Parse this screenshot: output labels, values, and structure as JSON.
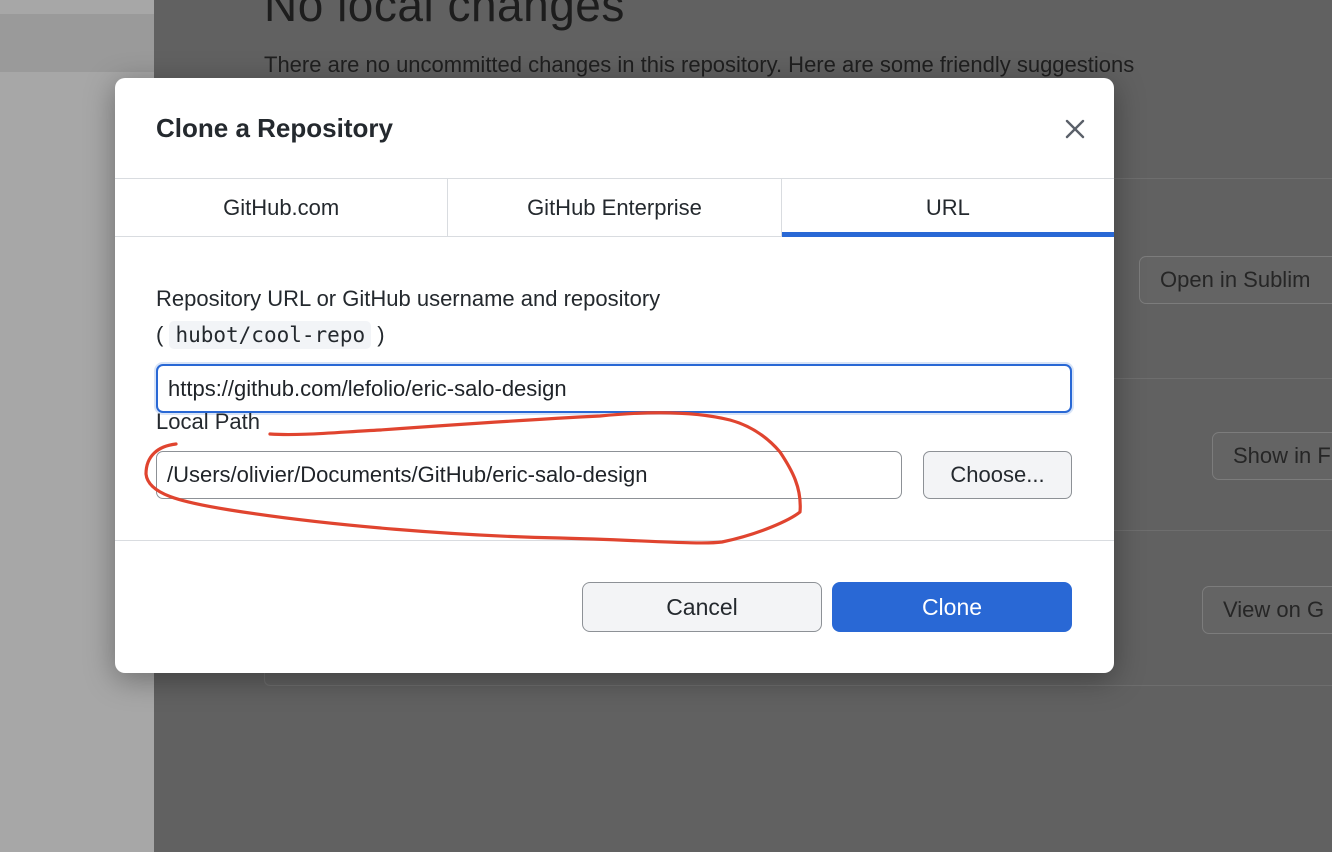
{
  "background": {
    "title": "No local changes",
    "subtitle": "There are no uncommitted changes in this repository. Here are some friendly suggestions",
    "buttons": [
      "Open in Sublim",
      "Show in F",
      "View on G"
    ]
  },
  "dialog": {
    "title": "Clone a Repository",
    "tabs": [
      {
        "label": "GitHub.com",
        "selected": false
      },
      {
        "label": "GitHub Enterprise",
        "selected": false
      },
      {
        "label": "URL",
        "selected": true
      }
    ],
    "repo_label": "Repository URL or GitHub username and repository",
    "repo_hint_open": "(",
    "repo_hint_code": "hubot/cool-repo",
    "repo_hint_close": ")",
    "repo_value": "https://github.com/lefolio/eric-salo-design",
    "local_path_label": "Local Path",
    "local_path_value": "/Users/olivier/Documents/GitHub/eric-salo-design",
    "choose_label": "Choose...",
    "cancel_label": "Cancel",
    "clone_label": "Clone"
  },
  "colors": {
    "accent": "#2968d5",
    "annotation": "#e0442f"
  },
  "icons": {
    "close": "close-icon"
  }
}
